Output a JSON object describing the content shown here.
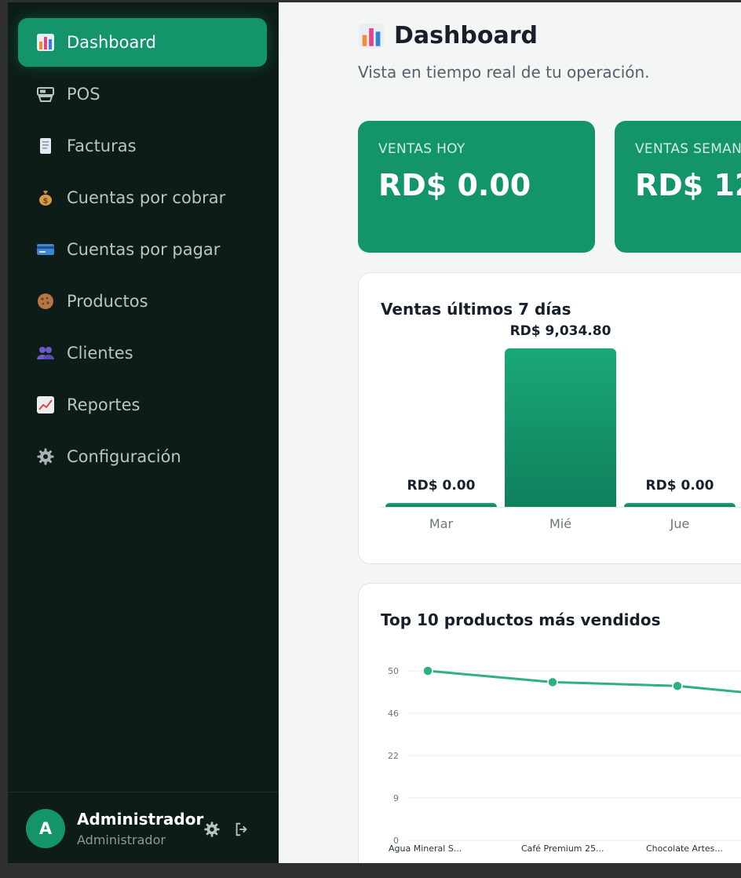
{
  "sidebar": {
    "items": [
      {
        "label": "Dashboard",
        "icon": "bar-chart-icon",
        "active": true
      },
      {
        "label": "POS",
        "icon": "cash-register-icon"
      },
      {
        "label": "Facturas",
        "icon": "document-icon"
      },
      {
        "label": "Cuentas por cobrar",
        "icon": "money-bag-icon"
      },
      {
        "label": "Cuentas por pagar",
        "icon": "credit-card-icon"
      },
      {
        "label": "Productos",
        "icon": "cookie-icon"
      },
      {
        "label": "Clientes",
        "icon": "users-icon"
      },
      {
        "label": "Reportes",
        "icon": "trend-chart-icon"
      },
      {
        "label": "Configuración",
        "icon": "gear-icon"
      }
    ],
    "user": {
      "initial": "A",
      "name": "Administrador",
      "role": "Administrador"
    }
  },
  "header": {
    "title": "Dashboard",
    "subtitle": "Vista en tiempo real de tu operación."
  },
  "stats": [
    {
      "label": "VENTAS HOY",
      "value": "RD$ 0.00"
    },
    {
      "label": "VENTAS SEMAN",
      "value": "RD$ 12,"
    }
  ],
  "colors": {
    "accent": "#14946b",
    "sidebar_bg": "#0d1c17",
    "line": "#2fb07f"
  },
  "chart_data": [
    {
      "type": "bar",
      "title": "Ventas últimos 7 días",
      "categories": [
        "Mar",
        "Mié",
        "Jue"
      ],
      "values": [
        0,
        9034.8,
        0
      ],
      "value_labels": [
        "RD$ 0.00",
        "RD$ 9,034.80",
        "RD$ 0.00"
      ],
      "ylim": [
        0,
        9034.8
      ]
    },
    {
      "type": "line",
      "title": "Top 10 productos más vendidos",
      "categories": [
        "Agua Mineral S...",
        "Café Premium 25...",
        "Chocolate Artes..."
      ],
      "values": [
        50,
        48.8,
        48.4
      ],
      "yticks": [
        "50",
        "46",
        "22",
        "9",
        "0"
      ],
      "grid": true
    }
  ]
}
